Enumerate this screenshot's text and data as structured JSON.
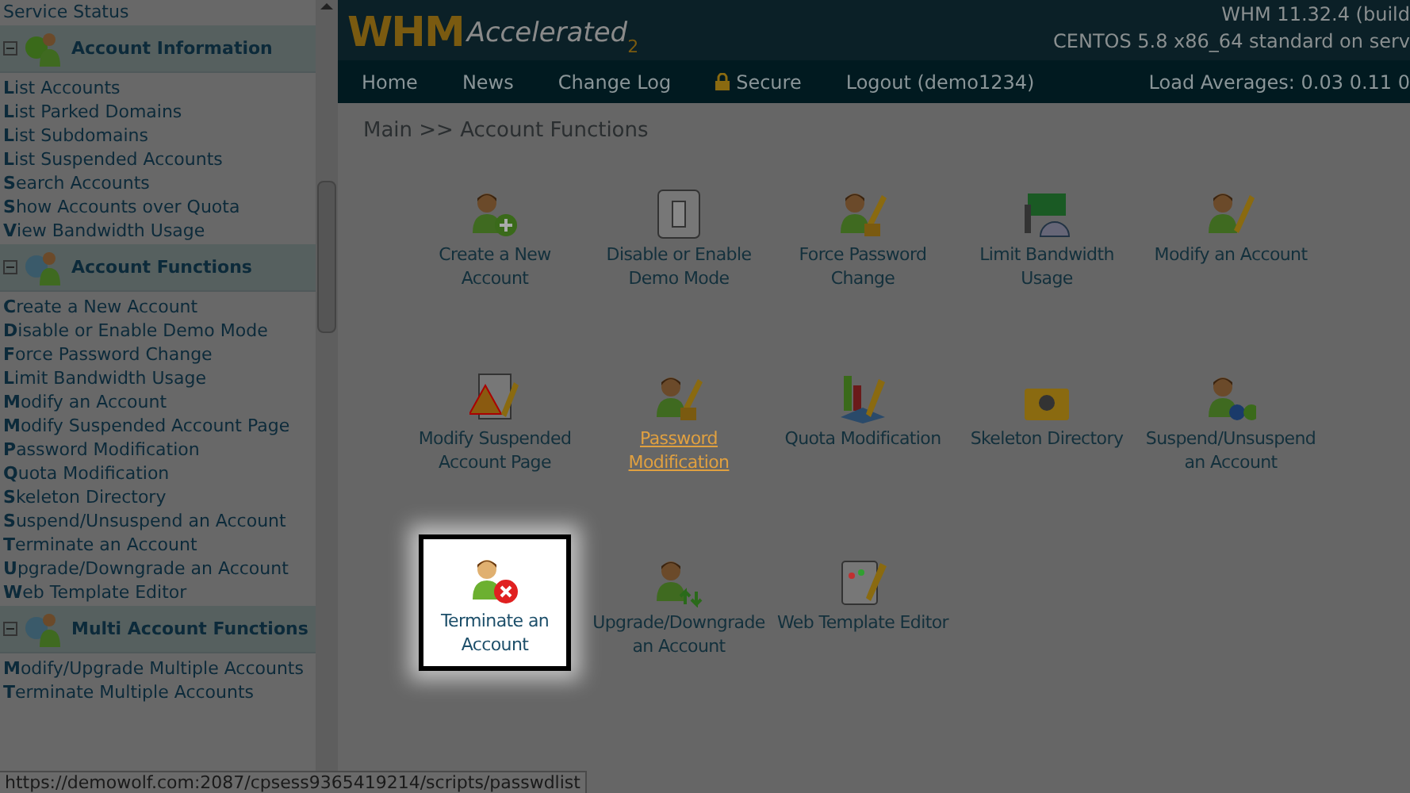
{
  "sidebar": {
    "top_item": "Service Status",
    "sections": [
      {
        "title": "Account Information",
        "expanded": true,
        "items": [
          "**L**ist Accounts",
          "**L**ist Parked Domains",
          "**L**ist Subdomains",
          "**L**ist Suspended Accounts",
          "**S**earch Accounts",
          "**S**how Accounts over Quota",
          "**V**iew Bandwidth Usage"
        ]
      },
      {
        "title": "Account Functions",
        "expanded": true,
        "items": [
          "**C**reate a New Account",
          "**D**isable or Enable Demo Mode",
          "**F**orce Password Change",
          "**L**imit Bandwidth Usage",
          "**M**odify an Account",
          "**M**odify Suspended Account Page",
          "**P**assword Modification",
          "**Q**uota Modification",
          "**S**keleton Directory",
          "**S**uspend/Unsuspend an Account",
          "**T**erminate an Account",
          "**U**pgrade/Downgrade an Account",
          "**W**eb Template Editor"
        ]
      },
      {
        "title": "Multi Account Functions",
        "expanded": true,
        "items": [
          "**M**odify/Upgrade Multiple Accounts",
          "**T**erminate Multiple Accounts"
        ]
      }
    ]
  },
  "header": {
    "logo": {
      "main": "WHM",
      "sub": "Accelerated",
      "version": "2"
    },
    "info": [
      "WHM 11.32.4 (build",
      "CENTOS 5.8 x86_64 standard on serv"
    ]
  },
  "nav": {
    "items": [
      {
        "label": "Home",
        "kind": "link"
      },
      {
        "label": "News",
        "kind": "link"
      },
      {
        "label": "Change Log",
        "kind": "link"
      },
      {
        "label": "Secure",
        "kind": "lock"
      },
      {
        "label": "Logout (demo1234)",
        "kind": "link"
      }
    ],
    "load": "Load Averages: 0.03 0.11 0"
  },
  "breadcrumb": "Main >> Account Functions",
  "tiles": [
    {
      "label": "Create a New Account",
      "selected": false,
      "hovered": false
    },
    {
      "label": "Disable or Enable Demo Mode",
      "selected": false,
      "hovered": false
    },
    {
      "label": "Force Password Change",
      "selected": false,
      "hovered": false
    },
    {
      "label": "Limit Bandwidth Usage",
      "selected": false,
      "hovered": false
    },
    {
      "label": "Modify an Account",
      "selected": false,
      "hovered": false
    },
    {
      "label": "Modify Suspended Account Page",
      "selected": false,
      "hovered": false
    },
    {
      "label": "Password Modification",
      "selected": false,
      "hovered": true
    },
    {
      "label": "Quota Modification",
      "selected": false,
      "hovered": false
    },
    {
      "label": "Skeleton Directory",
      "selected": false,
      "hovered": false
    },
    {
      "label": "Suspend/Unsuspend an Account",
      "selected": false,
      "hovered": false
    },
    {
      "label": "Terminate an Account",
      "selected": true,
      "hovered": false
    },
    {
      "label": "Upgrade/Downgrade an Account",
      "selected": false,
      "hovered": false
    },
    {
      "label": "Web Template Editor",
      "selected": false,
      "hovered": false
    }
  ],
  "status_bar": "https://demowolf.com:2087/cpsess9365419214/scripts/passwdlist"
}
